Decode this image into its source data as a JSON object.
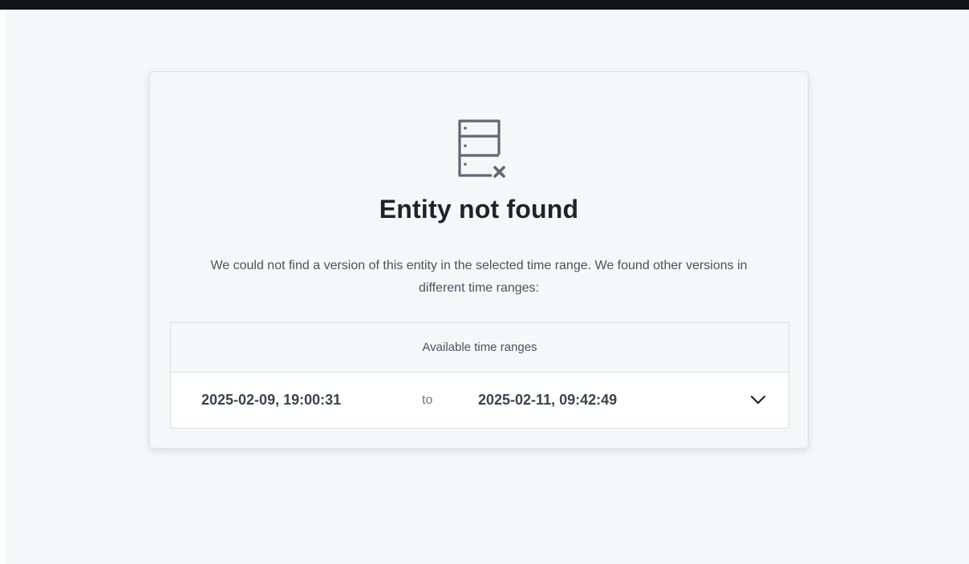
{
  "empty_state": {
    "icon": "server-x-icon",
    "title": "Entity not found",
    "description": "We could not find a version of this entity in the selected time range. We found other versions in different time ranges:"
  },
  "time_ranges": {
    "header": "Available time ranges",
    "rows": [
      {
        "start": "2025-02-09, 19:00:31",
        "separator": "to",
        "end": "2025-02-11, 09:42:49",
        "expand_icon": "chevron-down-icon"
      }
    ]
  },
  "colors": {
    "top_bar": "#111417",
    "page_background": "#f5f7f9",
    "icon": "#5f6875",
    "title": "#1e2329",
    "text": "#4a5260"
  }
}
